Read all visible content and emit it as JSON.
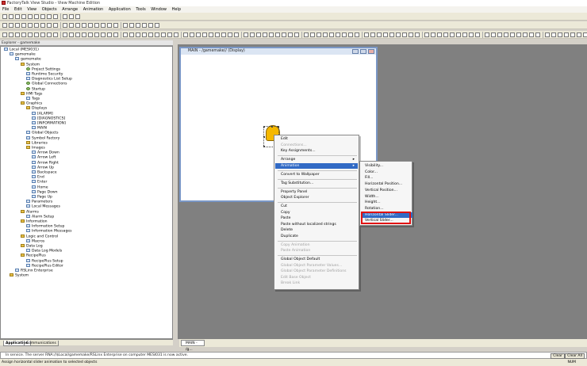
{
  "window": {
    "title": "FactoryTalk View Studio - View Machine Edition"
  },
  "menubar": [
    "File",
    "Edit",
    "View",
    "Objects",
    "Arrange",
    "Animation",
    "Application",
    "Tools",
    "Window",
    "Help"
  ],
  "explorer": {
    "title": "Explorer - gamemake",
    "tree": [
      {
        "label": "Local (MESI031)",
        "depth": 0,
        "icon": "computer-icon"
      },
      {
        "label": "gamemake",
        "depth": 1,
        "icon": "application-icon"
      },
      {
        "label": "gamemake",
        "depth": 2,
        "icon": "hmi-server-icon"
      },
      {
        "label": "System",
        "depth": 3,
        "icon": "folder-icon"
      },
      {
        "label": "Project Settings",
        "depth": 4,
        "icon": "settings-icon"
      },
      {
        "label": "Runtime Security",
        "depth": 4,
        "icon": "lock-icon"
      },
      {
        "label": "Diagnostics List Setup",
        "depth": 4,
        "icon": "item-icon"
      },
      {
        "label": "Global Connections",
        "depth": 4,
        "icon": "link-icon"
      },
      {
        "label": "Startup",
        "depth": 4,
        "icon": "startup-icon"
      },
      {
        "label": "HMI Tags",
        "depth": 3,
        "icon": "folder-icon"
      },
      {
        "label": "Tags",
        "depth": 4,
        "icon": "tag-icon"
      },
      {
        "label": "Graphics",
        "depth": 3,
        "icon": "folder-icon"
      },
      {
        "label": "Displays",
        "depth": 4,
        "icon": "folder-icon"
      },
      {
        "label": "[ALARM]",
        "depth": 5,
        "icon": "display-icon"
      },
      {
        "label": "[DIAGNOSTICS]",
        "depth": 5,
        "icon": "display-icon"
      },
      {
        "label": "[INFORMATION]",
        "depth": 5,
        "icon": "display-icon"
      },
      {
        "label": "MAIN",
        "depth": 5,
        "icon": "display-icon"
      },
      {
        "label": "Global Objects",
        "depth": 4,
        "icon": "item-icon"
      },
      {
        "label": "Symbol Factory",
        "depth": 4,
        "icon": "item-icon"
      },
      {
        "label": "Libraries",
        "depth": 4,
        "icon": "folder-icon"
      },
      {
        "label": "Images",
        "depth": 4,
        "icon": "folder-icon"
      },
      {
        "label": "Arrow Down",
        "depth": 5,
        "icon": "image-icon"
      },
      {
        "label": "Arrow Left",
        "depth": 5,
        "icon": "image-icon"
      },
      {
        "label": "Arrow Right",
        "depth": 5,
        "icon": "image-icon"
      },
      {
        "label": "Arrow Up",
        "depth": 5,
        "icon": "image-icon"
      },
      {
        "label": "Backspace",
        "depth": 5,
        "icon": "image-icon"
      },
      {
        "label": "End",
        "depth": 5,
        "icon": "image-icon"
      },
      {
        "label": "Enter",
        "depth": 5,
        "icon": "image-icon"
      },
      {
        "label": "Home",
        "depth": 5,
        "icon": "image-icon"
      },
      {
        "label": "Page Down",
        "depth": 5,
        "icon": "image-icon"
      },
      {
        "label": "Page Up",
        "depth": 5,
        "icon": "image-icon"
      },
      {
        "label": "Parameters",
        "depth": 4,
        "icon": "item-icon"
      },
      {
        "label": "Local Messages",
        "depth": 4,
        "icon": "item-icon"
      },
      {
        "label": "Alarms",
        "depth": 3,
        "icon": "folder-icon"
      },
      {
        "label": "Alarm Setup",
        "depth": 4,
        "icon": "alarm-icon"
      },
      {
        "label": "Information",
        "depth": 3,
        "icon": "folder-icon"
      },
      {
        "label": "Information Setup",
        "depth": 4,
        "icon": "item-icon"
      },
      {
        "label": "Information Messages",
        "depth": 4,
        "icon": "item-icon"
      },
      {
        "label": "Logic and Control",
        "depth": 3,
        "icon": "folder-icon"
      },
      {
        "label": "Macros",
        "depth": 4,
        "icon": "item-icon"
      },
      {
        "label": "Data Log",
        "depth": 3,
        "icon": "folder-icon"
      },
      {
        "label": "Data Log Models",
        "depth": 4,
        "icon": "item-icon"
      },
      {
        "label": "RecipePlus",
        "depth": 3,
        "icon": "folder-icon"
      },
      {
        "label": "RecipePlus Setup",
        "depth": 4,
        "icon": "item-icon"
      },
      {
        "label": "RecipePlus Editor",
        "depth": 4,
        "icon": "item-icon"
      },
      {
        "label": "RSLinx Enterprise",
        "depth": 2,
        "icon": "rslinx-icon"
      },
      {
        "label": "System",
        "depth": 1,
        "icon": "folder-icon"
      }
    ],
    "tabs": [
      "Application",
      "Communications"
    ]
  },
  "display_window": {
    "title": "MAIN - /gamemake// (Display)"
  },
  "context_menu": [
    {
      "label": "Edit",
      "state": "enabled"
    },
    {
      "label": "Connections...",
      "state": "disabled"
    },
    {
      "label": "Key Assignments...",
      "state": "enabled"
    },
    {
      "sep": true
    },
    {
      "label": "Arrange",
      "state": "enabled",
      "submenu": true
    },
    {
      "label": "Animation",
      "state": "highlighted",
      "submenu": true
    },
    {
      "sep": true
    },
    {
      "label": "Convert to Wallpaper",
      "state": "enabled"
    },
    {
      "sep": true
    },
    {
      "label": "Tag Substitution...",
      "state": "enabled"
    },
    {
      "sep": true
    },
    {
      "label": "Property Panel",
      "state": "enabled"
    },
    {
      "label": "Object Explorer",
      "state": "enabled"
    },
    {
      "sep": true
    },
    {
      "label": "Cut",
      "state": "enabled"
    },
    {
      "label": "Copy",
      "state": "enabled"
    },
    {
      "label": "Paste",
      "state": "enabled"
    },
    {
      "label": "Paste without localized strings",
      "state": "enabled"
    },
    {
      "label": "Delete",
      "state": "enabled"
    },
    {
      "label": "Duplicate",
      "state": "enabled"
    },
    {
      "sep": true
    },
    {
      "label": "Copy Animation",
      "state": "disabled"
    },
    {
      "label": "Paste Animation",
      "state": "disabled"
    },
    {
      "sep": true
    },
    {
      "label": "Global Object Default",
      "state": "enabled"
    },
    {
      "label": "Global Object Parameter Values...",
      "state": "disabled"
    },
    {
      "label": "Global Object Parameter Definitions",
      "state": "disabled"
    },
    {
      "label": "Edit Base Object",
      "state": "disabled"
    },
    {
      "label": "Break Link",
      "state": "disabled"
    }
  ],
  "animation_submenu": [
    {
      "label": "Visibility...",
      "state": "enabled"
    },
    {
      "label": "Color...",
      "state": "enabled"
    },
    {
      "label": "Fill...",
      "state": "enabled"
    },
    {
      "label": "Horizontal Position...",
      "state": "enabled"
    },
    {
      "label": "Vertical Position...",
      "state": "enabled"
    },
    {
      "label": "Width...",
      "state": "enabled"
    },
    {
      "label": "Height...",
      "state": "enabled"
    },
    {
      "label": "Rotation...",
      "state": "enabled"
    },
    {
      "label": "Horizontal Slider...",
      "state": "highlighted"
    },
    {
      "label": "Vertical Slider...",
      "state": "enabled"
    }
  ],
  "window_tab": {
    "label": "MAIN - /g..."
  },
  "diagnostics": {
    "message": "In service. The server RNA://$Local/gamemake/RSLinx Enterprise on computer MESI031 is now active.",
    "clear_label": "Clear",
    "clear_all_label": "Clear All"
  },
  "status": {
    "message": "Assign horizontal slider animation to selected objects",
    "num": "NUM"
  },
  "colors": {
    "highlight": "#316ac5",
    "annotation_red": "#e01010",
    "workspace_gray": "#808080",
    "graphic_yellow": "#f5b800"
  }
}
